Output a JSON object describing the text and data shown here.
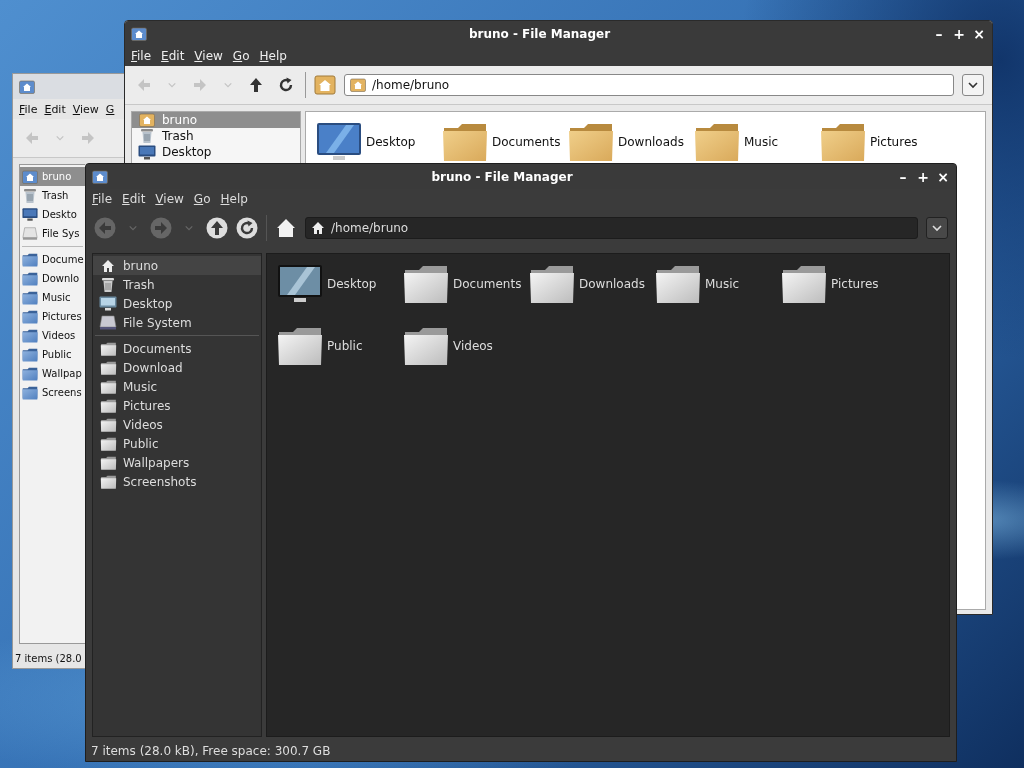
{
  "back_window": {
    "menu": [
      "File",
      "Edit",
      "View",
      "G"
    ],
    "toolbar": [
      {
        "kind": "back",
        "disabled": true
      },
      {
        "kind": "dropdown",
        "disabled": true
      },
      {
        "kind": "forward",
        "disabled": true
      }
    ],
    "places": [
      {
        "kind": "home",
        "label": "bruno",
        "selected": true
      },
      {
        "kind": "trash",
        "label": "Trash",
        "selected": false
      },
      {
        "kind": "desktop",
        "label": "Deskto",
        "selected": false
      },
      {
        "kind": "filesystem",
        "label": "File Sys",
        "selected": false
      }
    ],
    "bookmarks": [
      {
        "label": "Docume",
        "selected": false
      },
      {
        "label": "Downlo",
        "selected": false
      },
      {
        "label": "Music",
        "selected": false
      },
      {
        "label": "Pictures",
        "selected": false
      },
      {
        "label": "Videos",
        "selected": false
      },
      {
        "label": "Public",
        "selected": false
      },
      {
        "label": "Wallpap",
        "selected": false
      },
      {
        "label": "Screens",
        "selected": false
      }
    ],
    "status": "7 items (28.0"
  },
  "middle_window": {
    "title": "bruno - File Manager",
    "controls": [
      "–",
      "+",
      "×"
    ],
    "menu": [
      "File",
      "Edit",
      "View",
      "Go",
      "Help"
    ],
    "toolbar": [
      {
        "kind": "back",
        "disabled": true
      },
      {
        "kind": "dropdown",
        "disabled": true
      },
      {
        "kind": "forward",
        "disabled": true
      },
      {
        "kind": "dropdown",
        "disabled": true
      },
      {
        "kind": "up",
        "disabled": false
      },
      {
        "kind": "reload",
        "disabled": false
      },
      {
        "kind": "home"
      }
    ],
    "path": "/home/bruno",
    "places": [
      {
        "kind": "home",
        "label": "bruno",
        "selected": true
      },
      {
        "kind": "trash",
        "label": "Trash",
        "selected": false
      },
      {
        "kind": "desktop",
        "label": "Desktop",
        "selected": false
      }
    ],
    "items": [
      {
        "kind": "desktop",
        "label": "Desktop"
      },
      {
        "kind": "folder",
        "label": "Documents"
      },
      {
        "kind": "folder",
        "label": "Downloads"
      },
      {
        "kind": "folder",
        "label": "Music"
      },
      {
        "kind": "folder",
        "label": "Pictures"
      }
    ]
  },
  "front_window": {
    "title": "bruno - File Manager",
    "controls": [
      "–",
      "+",
      "×"
    ],
    "menu": [
      "File",
      "Edit",
      "View",
      "Go",
      "Help"
    ],
    "toolbar": [
      {
        "kind": "back",
        "disabled": true
      },
      {
        "kind": "dropdown",
        "disabled": true
      },
      {
        "kind": "forward",
        "disabled": true
      },
      {
        "kind": "dropdown",
        "disabled": true
      },
      {
        "kind": "up",
        "disabled": false
      },
      {
        "kind": "reload",
        "disabled": false
      },
      {
        "kind": "home"
      }
    ],
    "path": "/home/bruno",
    "places": [
      {
        "kind": "home",
        "label": "bruno",
        "selected": true
      },
      {
        "kind": "trash",
        "label": "Trash",
        "selected": false
      },
      {
        "kind": "desktop",
        "label": "Desktop",
        "selected": false
      },
      {
        "kind": "filesystem",
        "label": "File System",
        "selected": false
      }
    ],
    "bookmarks": [
      {
        "label": "Documents",
        "selected": false
      },
      {
        "label": "Download",
        "selected": false
      },
      {
        "label": "Music",
        "selected": false
      },
      {
        "label": "Pictures",
        "selected": false
      },
      {
        "label": "Videos",
        "selected": false
      },
      {
        "label": "Public",
        "selected": false
      },
      {
        "label": "Wallpapers",
        "selected": false
      },
      {
        "label": "Screenshots",
        "selected": false
      }
    ],
    "items": [
      {
        "kind": "desktop",
        "label": "Desktop"
      },
      {
        "kind": "folder",
        "label": "Documents"
      },
      {
        "kind": "folder",
        "label": "Downloads"
      },
      {
        "kind": "folder",
        "label": "Music"
      },
      {
        "kind": "folder",
        "label": "Pictures"
      },
      {
        "kind": "folder",
        "label": "Public"
      },
      {
        "kind": "folder",
        "label": "Videos"
      }
    ],
    "status": "7 items (28.0 kB), Free space: 300.7 GB"
  }
}
